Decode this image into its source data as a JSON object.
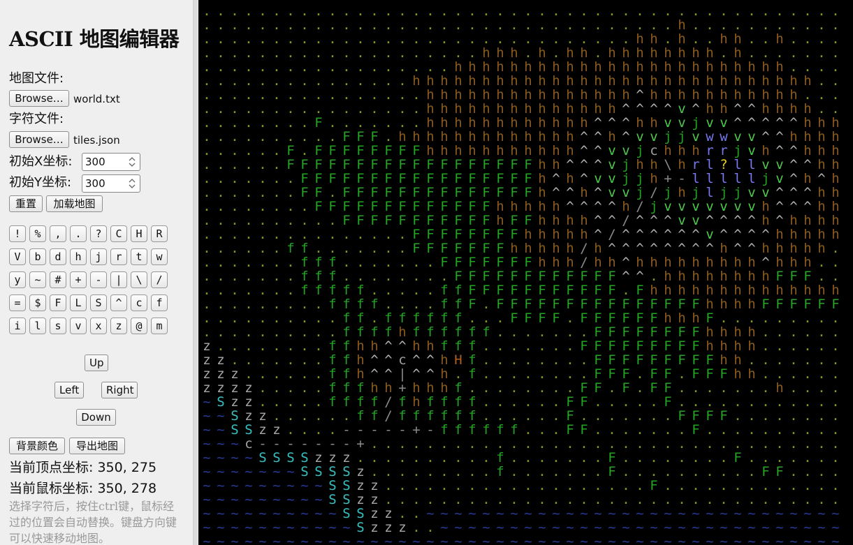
{
  "app": {
    "title": "ASCII 地图编辑器"
  },
  "files": {
    "map_label": "地图文件:",
    "map_button": "Browse…",
    "map_filename": "world.txt",
    "tile_label": "字符文件:",
    "tile_button": "Browse…",
    "tile_filename": "tiles.json"
  },
  "inputs": {
    "x_label": "初始X坐标:",
    "x_value": "300",
    "y_label": "初始Y坐标:",
    "y_value": "300"
  },
  "actions": {
    "reset": "重置",
    "load": "加载地图",
    "bg_color": "背景颜色",
    "export": "导出地图"
  },
  "tiles": [
    "!",
    "%",
    ",",
    ".",
    "?",
    "C",
    "H",
    "R",
    "V",
    "b",
    "d",
    "h",
    "j",
    "r",
    "t",
    "w",
    "y",
    "~",
    "#",
    "+",
    "-",
    "|",
    "\\",
    "/",
    "=",
    "$",
    "F",
    "L",
    "S",
    "^",
    "c",
    "f",
    "i",
    "l",
    "s",
    "v",
    "x",
    "z",
    "@",
    "m"
  ],
  "nav": {
    "up": "Up",
    "left": "Left",
    "right": "Right",
    "down": "Down"
  },
  "status": {
    "top_label": "当前顶点坐标:",
    "top_value": "350, 275",
    "mouse_label": "当前鼠标坐标:",
    "mouse_value": "350, 278"
  },
  "help": "选择字符后，按住ctrl键，鼠标经过的位置会自动替换。键盘方向键可以快速移动地图。",
  "colors": {
    "dot": "#8c9a1e",
    "water": "#2a3a9a",
    "h": "#8a5a1c",
    "caret": "#b5b5b5",
    "F": "#23a423",
    "f": "#23a423",
    "v": "#4fc84f",
    "S": "#3ac0c0",
    "z": "#a8a8a8",
    "l": "#7777ee",
    "r": "#7777ee",
    "w": "#7777ee",
    "qmark": "#e6d21a",
    "j": "#23a423",
    "c": "#a0a0a0",
    "H": "#b0601c",
    "punct": "#8a8a8a"
  },
  "map_rows": [
    "...............................................",
    "..................................h............",
    "...............................hh.h..hh..h.....",
    "....................hhh.h.hh.hhhhhhhh.h........",
    "..................hhhhhhhhhhhhhhhhhhhhhhhh.....",
    "...............hhhhhhhhhhhhhhhhhhhhhhhhhhhhh...",
    "................hhhhhhhhhhhhhhh^hhhhhhhhhhh....",
    "................hhhhhhhhhhhhhh^^^^v^hh^^hhhh...",
    "........F.......hhhhhhhhhhhh^^^hhvvjvv^^^^^hhh.",
    "..........FFF.hhhhhhhhhhhhh^^h^vvjjvwwvv^^hhhhh",
    "......F.FFFFFFFFhhhhhhhhhhh^^vvjchhhrrjvh^^hhhh",
    "......FFFFFFFFFFFFFFFFFFhh^^^vjhh\\hrl?llvv^^hhh",
    ".......FFFFFFFFFFFFFFFFFh^h^vvjjh+-llllljv^h^hh",
    ".......FF.FFFFFFFFFFFFFFh^^h^vvj/jhjljjvv^^^hhh",
    "........FFFFFFFFFFFFFhhhhh^^^^h/jvvvvvvvh^^^hhh",
    "..........FFFFFFFFFFFhFFhhhh^^/^^^vv^^^^h^hhhhh",
    "...............FFFFFFFFhhhhh^/^^^^^^v^^^^hhhhh.",
    "......ff.......FFFFFFFhhhhh/h^^^^^^^^h^^hhhhh..",
    ".......fff.......FFFFFFFhhh/hh^hhhhhhhhh^hhh...",
    ".......fff........FFFFFFFFFFFF^^.hhhhhhhhFFF...",
    ".......fffff.....ffFFFFFFFFFFF.Fhhhhhhhhhhhhhh.",
    ".........ffff....ffF.FFFFFFFFFFFFFFFhhhhFFFFFFF",
    "..........ff.ffffff...FFFF.FFFFFFhhhF..........",
    "..........ffffhffffff.......FFFFFFFFhhhh.......",
    "z........ffhh^^hhfff.......FFFFFFFFFhhhh.......",
    "zz.......ffh^^c^^hHf........FFFFFFFFFhh........",
    "zzz......ffh^^|^^h.f........FFF.FF.FFFhh.......",
    "zzzz.....fffhh+hhhf........FF.F.FF.......h.....",
    "~Szz.....ffff/fhffff......FF.....F.............",
    "~~Szz......ff/ffffff......F.......FFFF.........",
    "~~SSzz....-----+-ffffff...FF.......F...........",
    "~~~c-------+...................................",
    "~~~~SSSSzzz..........f.......F........F........",
    "~~~~~~~SSSSz.........f.......F..........FF.....",
    "~~~~~~~~~SSzz...................F..............",
    "~~~~~~~~~SSzz..................................",
    "~~~~~~~~~~SSzz..~~~~~~~~~~~~~~~~~~~~~~~~~~~~~~~",
    "~~~~~~~~~~~SzzZ..~~~~~~~~~~~~~~~~~~~~~~~~~~~~~~",
    "~~~~~~~~~~~~~~~~~~~~~~~~~~~~~~~~~~~~~~~~~~~~~~~"
  ]
}
